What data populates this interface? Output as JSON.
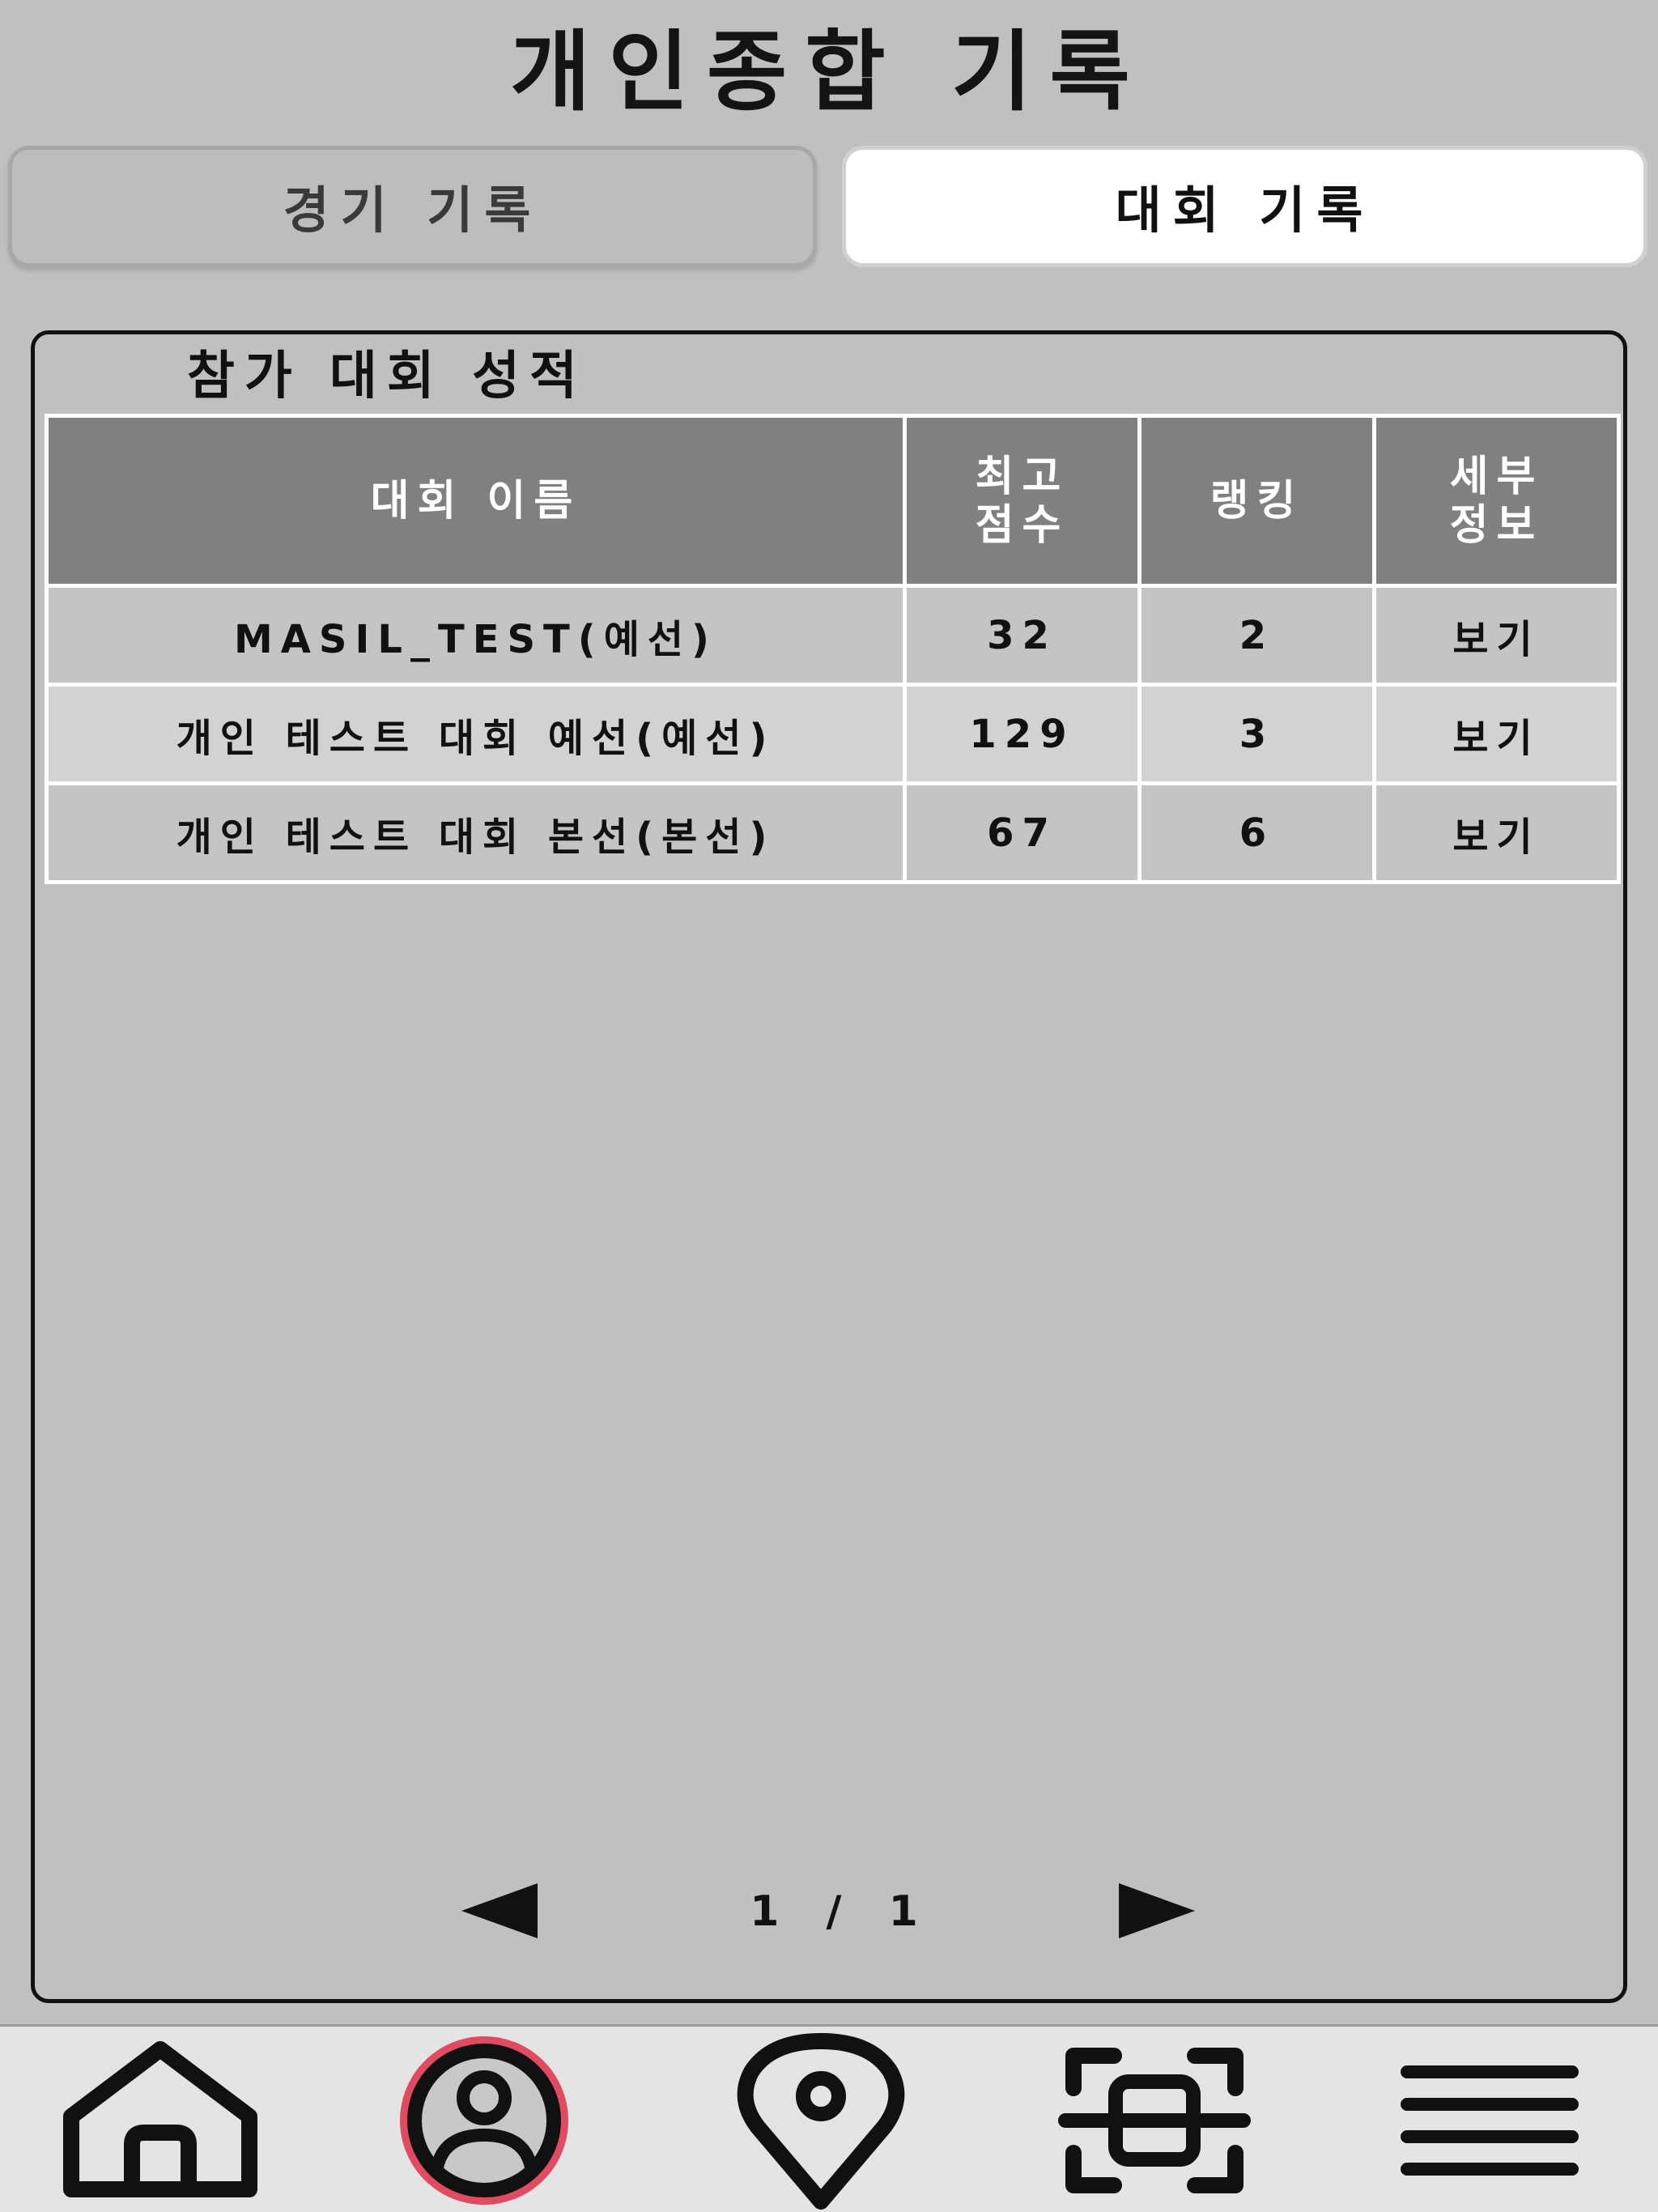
{
  "header": {
    "title": "개인종합 기록"
  },
  "tabs": [
    {
      "label": "경기 기록",
      "active": false
    },
    {
      "label": "대회 기록",
      "active": true
    }
  ],
  "panel": {
    "title": "참가 대회 성적",
    "table": {
      "headers": [
        "대회 이름",
        "최고 점수",
        "랭킹",
        "세부 정보"
      ],
      "rows": [
        {
          "name": "MASIL_TEST(예선)",
          "score": "32",
          "rank": "2",
          "detail": "보기"
        },
        {
          "name": "개인 테스트 대회 예선(예선)",
          "score": "129",
          "rank": "3",
          "detail": "보기"
        },
        {
          "name": "개인 테스트 대회 본선(본선)",
          "score": "67",
          "rank": "6",
          "detail": "보기"
        }
      ]
    }
  },
  "pagination": {
    "text": "1 / 1",
    "prev_icon": "triangle-left-icon",
    "next_icon": "triangle-right-icon"
  },
  "bottom_nav": {
    "items": [
      {
        "icon": "home-icon",
        "active": false
      },
      {
        "icon": "user-profile-icon",
        "active": true
      },
      {
        "icon": "location-pin-icon",
        "active": false
      },
      {
        "icon": "qr-scan-icon",
        "active": false
      },
      {
        "icon": "hamburger-menu-icon",
        "active": false
      }
    ],
    "active_color": "#e0304a"
  },
  "colors": {
    "background": "#c0c0c0",
    "table_header": "#808080",
    "active_tab": "#ffffff"
  }
}
